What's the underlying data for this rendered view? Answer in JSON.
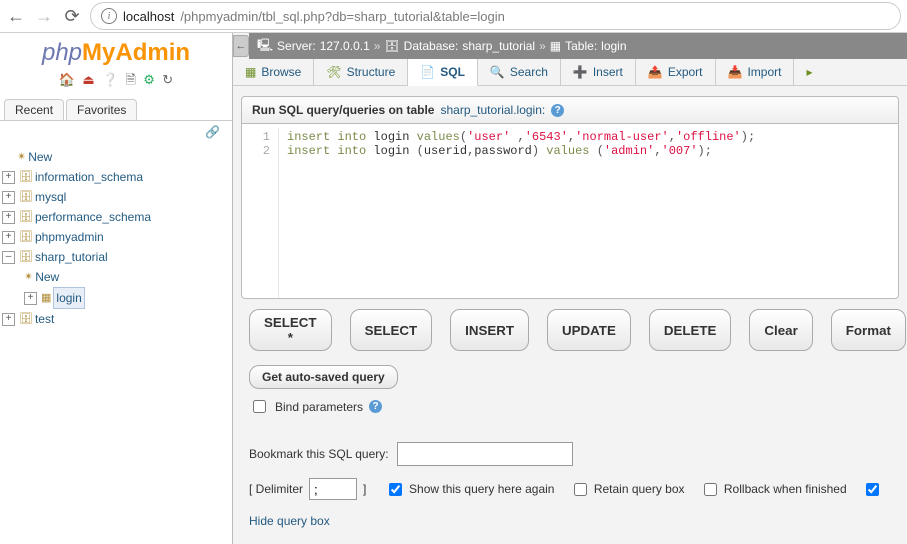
{
  "browser": {
    "url_host": "localhost",
    "url_path": "/phpmyadmin/tbl_sql.php?db=sharp_tutorial&table=login"
  },
  "sidebar": {
    "tabs": [
      "Recent",
      "Favorites"
    ],
    "tree": [
      {
        "label": "New",
        "icon": "✴"
      },
      {
        "label": "information_schema",
        "icon": "🗄"
      },
      {
        "label": "mysql",
        "icon": "🗄"
      },
      {
        "label": "performance_schema",
        "icon": "🗄"
      },
      {
        "label": "phpmyadmin",
        "icon": "🗄"
      },
      {
        "label": "sharp_tutorial",
        "icon": "🗄",
        "expanded": true,
        "children": [
          {
            "label": "New",
            "icon": "✴"
          },
          {
            "label": "login",
            "icon": "▦",
            "selected": true
          }
        ]
      },
      {
        "label": "test",
        "icon": "🗄"
      }
    ]
  },
  "breadcrumb": {
    "server_label": "Server:",
    "server_value": "127.0.0.1",
    "db_label": "Database:",
    "db_value": "sharp_tutorial",
    "table_label": "Table:",
    "table_value": "login"
  },
  "tabs": [
    {
      "label": "Browse"
    },
    {
      "label": "Structure"
    },
    {
      "label": "SQL",
      "active": true
    },
    {
      "label": "Search"
    },
    {
      "label": "Insert"
    },
    {
      "label": "Export"
    },
    {
      "label": "Import"
    }
  ],
  "sqlbox": {
    "title_a": "Run SQL query/queries on table ",
    "title_link": "sharp_tutorial.login:",
    "line1_html": "insert into login values('user' ,'6543','normal-user','offline');",
    "line2_html": "insert into login (userid,password) values ('admin','007');"
  },
  "buttons": {
    "select_star": "SELECT *",
    "select": "SELECT",
    "insert": "INSERT",
    "update": "UPDATE",
    "delete": "DELETE",
    "clear": "Clear",
    "format": "Format",
    "auto": "Get auto-saved query"
  },
  "controls": {
    "bind": "Bind parameters",
    "bookmark": "Bookmark this SQL query:",
    "delimiter_label": "[ Delimiter",
    "delimiter_value": ";",
    "delimiter_close": "]",
    "show_again": "Show this query here again",
    "retain": "Retain query box",
    "rollback": "Rollback when finished",
    "hide": "Hide query box"
  }
}
